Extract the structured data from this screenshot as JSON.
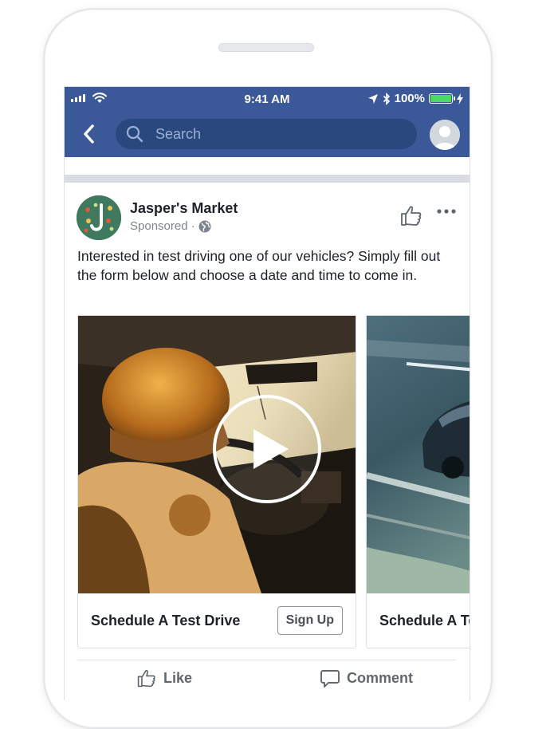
{
  "status_bar": {
    "time": "9:41 AM",
    "battery_text": "100%",
    "battery_color": "#4cd964"
  },
  "nav": {
    "search_placeholder": "Search",
    "brand_color": "#3b5998"
  },
  "post": {
    "page_name": "Jasper's Market",
    "sponsored_label": "Sponsored ·",
    "text": "Interested in test driving one of our vehicles? Simply fill out the form below and choose a date and time to come in."
  },
  "carousel": {
    "cards": [
      {
        "title": "Schedule A Test Drive",
        "button": "Sign Up"
      },
      {
        "title": "Schedule A Test Drive"
      }
    ]
  },
  "actions": {
    "like": "Like",
    "comment": "Comment"
  },
  "icons": [
    "signal-icon",
    "wifi-icon",
    "location-arrow-icon",
    "bluetooth-icon",
    "battery-icon",
    "charging-icon",
    "back-chevron-icon",
    "search-icon",
    "profile-avatar",
    "globe-icon",
    "thumbs-up-icon",
    "more-dots-icon",
    "play-icon",
    "comment-icon"
  ]
}
